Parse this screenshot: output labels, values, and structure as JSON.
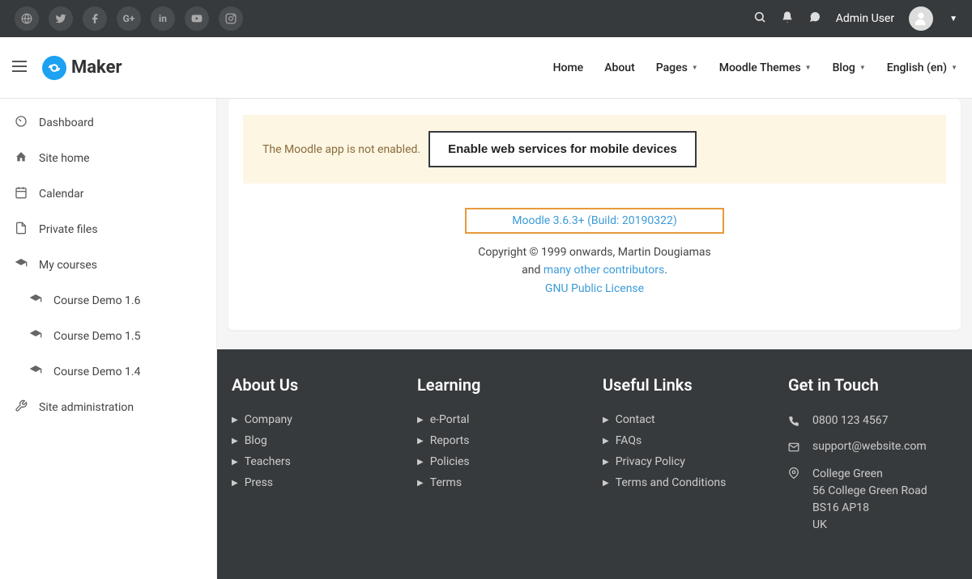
{
  "topbar": {
    "user": "Admin User"
  },
  "header": {
    "brand": "Maker",
    "nav": {
      "home": "Home",
      "about": "About",
      "pages": "Pages",
      "themes": "Moodle Themes",
      "blog": "Blog",
      "lang": "English (en)"
    }
  },
  "sidebar": {
    "dashboard": "Dashboard",
    "sitehome": "Site home",
    "calendar": "Calendar",
    "privatefiles": "Private files",
    "mycourses": "My courses",
    "course1": "Course Demo 1.6",
    "course2": "Course Demo 1.5",
    "course3": "Course Demo 1.4",
    "siteadmin": "Site administration"
  },
  "notice": {
    "text": "The Moodle app is not enabled.",
    "button": "Enable web services for mobile devices"
  },
  "version": {
    "link": "Moodle 3.6.3+ (Build: 20190322)",
    "copy1": "Copyright © 1999 onwards, Martin Dougiamas",
    "copy2a": "and ",
    "contributors": "many other contributors",
    "copy2b": ".",
    "license": "GNU Public License"
  },
  "footer": {
    "about": {
      "title": "About Us",
      "company": "Company",
      "blog": "Blog",
      "teachers": "Teachers",
      "press": "Press"
    },
    "learning": {
      "title": "Learning",
      "eportal": "e-Portal",
      "reports": "Reports",
      "policies": "Policies",
      "terms": "Terms"
    },
    "links": {
      "title": "Useful Links",
      "contact": "Contact",
      "faqs": "FAQs",
      "privacy": "Privacy Policy",
      "tandc": "Terms and Conditions"
    },
    "touch": {
      "title": "Get in Touch",
      "phone": "0800 123 4567",
      "email": "support@website.com",
      "addr1": "College Green",
      "addr2": "56 College Green Road",
      "addr3": "BS16 AP18",
      "addr4": "UK"
    }
  }
}
